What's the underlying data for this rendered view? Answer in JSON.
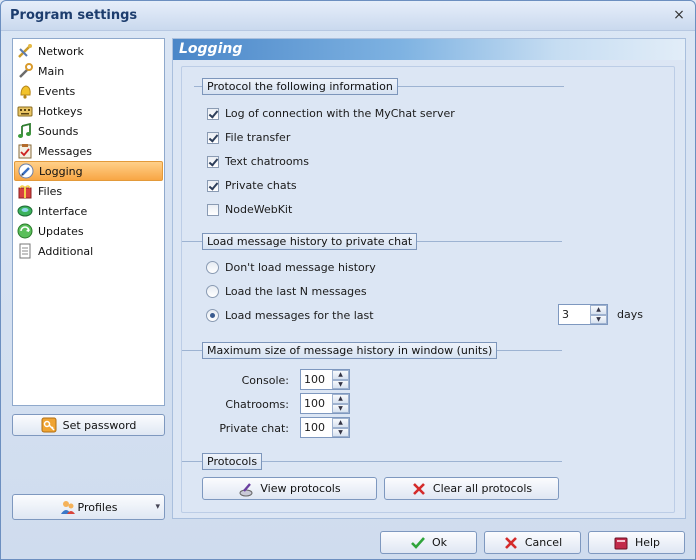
{
  "window": {
    "title": "Program settings",
    "close_glyph": "×"
  },
  "nav": {
    "items": [
      {
        "label": "Network",
        "icon": "network-icon"
      },
      {
        "label": "Main",
        "icon": "wrench-icon"
      },
      {
        "label": "Events",
        "icon": "bell-icon"
      },
      {
        "label": "Hotkeys",
        "icon": "keyboard-icon"
      },
      {
        "label": "Sounds",
        "icon": "music-note-icon"
      },
      {
        "label": "Messages",
        "icon": "clipboard-icon"
      },
      {
        "label": "Logging",
        "icon": "pencil-icon",
        "active": true
      },
      {
        "label": "Files",
        "icon": "files-icon"
      },
      {
        "label": "Interface",
        "icon": "interface-icon"
      },
      {
        "label": "Updates",
        "icon": "updates-icon"
      },
      {
        "label": "Additional",
        "icon": "document-icon"
      }
    ],
    "set_password_label": "Set password",
    "profiles_label": "Profiles",
    "profiles_arrow": "▾"
  },
  "panel": {
    "title": "Logging",
    "protocol_section": {
      "label": "Protocol the following information",
      "options": [
        {
          "label": "Log of connection with the MyChat server",
          "checked": true
        },
        {
          "label": "File transfer",
          "checked": true
        },
        {
          "label": "Text chatrooms",
          "checked": true
        },
        {
          "label": "Private chats",
          "checked": true
        },
        {
          "label": "NodeWebKit",
          "checked": false
        }
      ]
    },
    "history_section": {
      "label": "Load message history to private chat",
      "options": [
        {
          "label": "Don't load message history",
          "selected": false
        },
        {
          "label": "Load the last N messages",
          "selected": false
        },
        {
          "label": "Load messages for the last",
          "selected": true
        }
      ],
      "days_value": "3",
      "days_unit": "days"
    },
    "max_size_section": {
      "label": "Maximum size of message history in window (units)",
      "console_label": "Console:",
      "console_value": "100",
      "chatrooms_label": "Chatrooms:",
      "chatrooms_value": "100",
      "private_label": "Private chat:",
      "private_value": "100"
    },
    "protocols_section": {
      "label": "Protocols",
      "view_label": "View protocols",
      "clear_label": "Clear all protocols"
    }
  },
  "footer": {
    "ok_label": "Ok",
    "cancel_label": "Cancel",
    "help_label": "Help"
  },
  "spin_glyphs": {
    "up": "▲",
    "down": "▼"
  },
  "colors": {
    "accent_active": "#f8a644",
    "header_blue": "#4a86c8",
    "title_text": "#1d3d6e"
  }
}
